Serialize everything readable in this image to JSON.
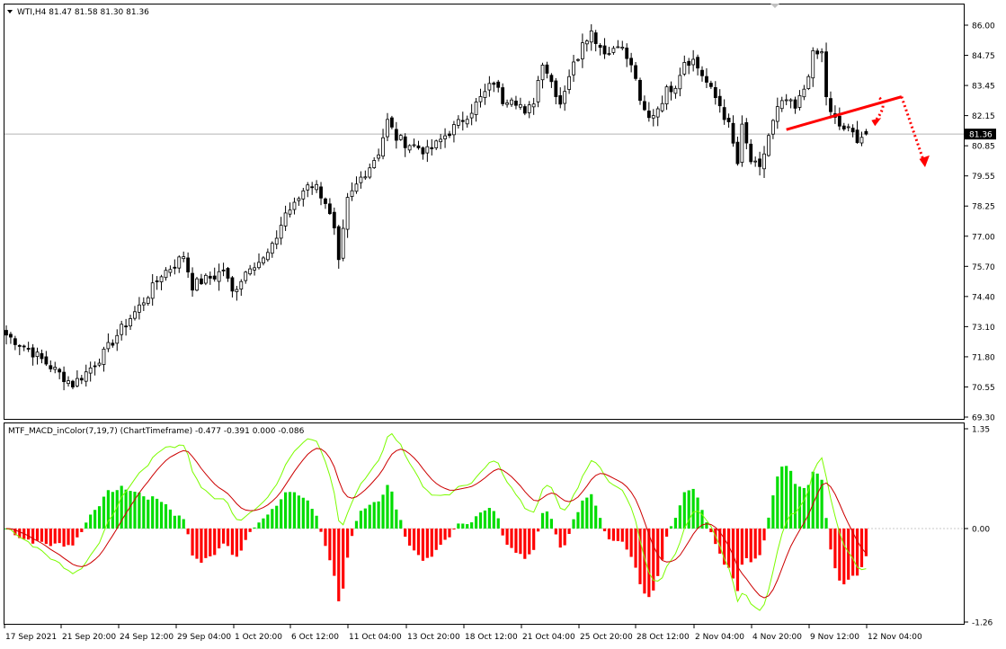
{
  "header": {
    "price_title": "WTI,H4  81.47 81.58 81.30 81.36",
    "indicator_title": "MTF_MACD_inColor(7,19,7) (ChartTimeframe) -0.477 -0.391 0.000 -0.086"
  },
  "colors": {
    "background": "#ffffff",
    "bull_candle": "#ffffff",
    "bear_candle": "#000000",
    "candle_wick": "#000000",
    "price_line": "#b4b4b4",
    "current_price_tag": "#000000",
    "annotation": "#ff0000",
    "macd_line": "#7cfc00",
    "signal_line": "#cc0000",
    "histogram_positive": "#00dd00",
    "histogram_negative": "#ff0000"
  },
  "chart_data": [
    {
      "type": "candlestick",
      "symbol": "WTI",
      "timeframe": "H4",
      "ohlc_last": {
        "open": 81.47,
        "high": 81.58,
        "low": 81.3,
        "close": 81.36
      },
      "current_price": "81.36",
      "ylim": [
        69.3,
        86.0
      ],
      "y_ticks": [
        "86.00",
        "84.75",
        "83.45",
        "82.15",
        "80.85",
        "79.55",
        "78.25",
        "77.00",
        "75.70",
        "74.40",
        "73.10",
        "71.80",
        "70.55",
        "69.30"
      ],
      "x_ticks": [
        "17 Sep 2021",
        "21 Sep 20:00",
        "24 Sep 12:00",
        "29 Sep 04:00",
        "1 Oct 20:00",
        "6 Oct 12:00",
        "11 Oct 04:00",
        "13 Oct 20:00",
        "18 Oct 12:00",
        "21 Oct 04:00",
        "25 Oct 20:00",
        "28 Oct 12:00",
        "2 Nov 04:00",
        "4 Nov 20:00",
        "9 Nov 12:00",
        "12 Nov 04:00"
      ],
      "close_path": [
        [
          0,
          72.8
        ],
        [
          5,
          72.2
        ],
        [
          9,
          71.6
        ],
        [
          13,
          71.0
        ],
        [
          15,
          70.7
        ],
        [
          18,
          71.2
        ],
        [
          22,
          72.0
        ],
        [
          25,
          72.8
        ],
        [
          27,
          73.3
        ],
        [
          30,
          74.0
        ],
        [
          33,
          74.8
        ],
        [
          35,
          75.4
        ],
        [
          38,
          75.8
        ],
        [
          40,
          76.2
        ],
        [
          42,
          74.9
        ],
        [
          44,
          75.1
        ],
        [
          47,
          75.3
        ],
        [
          49,
          75.6
        ],
        [
          51,
          74.6
        ],
        [
          53,
          75.2
        ],
        [
          55,
          75.8
        ],
        [
          58,
          76.0
        ],
        [
          60,
          76.5
        ],
        [
          63,
          78.0
        ],
        [
          65,
          78.3
        ],
        [
          68,
          79.3
        ],
        [
          70,
          79.1
        ],
        [
          72,
          78.5
        ],
        [
          74,
          77.2
        ],
        [
          75,
          75.8
        ],
        [
          77,
          78.5
        ],
        [
          80,
          79.5
        ],
        [
          82,
          80.0
        ],
        [
          84,
          80.6
        ],
        [
          86,
          81.9
        ],
        [
          88,
          81.2
        ],
        [
          90,
          81.0
        ],
        [
          93,
          80.8
        ],
        [
          95,
          80.6
        ],
        [
          97,
          80.9
        ],
        [
          99,
          81.3
        ],
        [
          102,
          81.8
        ],
        [
          105,
          82.4
        ],
        [
          108,
          83.1
        ],
        [
          110,
          83.6
        ],
        [
          112,
          82.8
        ],
        [
          114,
          83.0
        ],
        [
          116,
          82.6
        ],
        [
          117,
          82.1
        ],
        [
          119,
          82.8
        ],
        [
          121,
          84.5
        ],
        [
          123,
          83.6
        ],
        [
          125,
          82.7
        ],
        [
          127,
          83.9
        ],
        [
          129,
          84.7
        ],
        [
          130,
          85.4
        ],
        [
          132,
          85.7
        ],
        [
          134,
          85.1
        ],
        [
          136,
          84.8
        ],
        [
          138,
          85.3
        ],
        [
          140,
          84.6
        ],
        [
          142,
          83.8
        ],
        [
          143,
          82.6
        ],
        [
          145,
          82.0
        ],
        [
          147,
          82.5
        ],
        [
          149,
          83.2
        ],
        [
          151,
          83.5
        ],
        [
          153,
          84.5
        ],
        [
          155,
          84.5
        ],
        [
          157,
          83.9
        ],
        [
          159,
          83.2
        ],
        [
          161,
          82.6
        ],
        [
          163,
          81.7
        ],
        [
          165,
          80.1
        ],
        [
          166,
          81.6
        ],
        [
          168,
          80.2
        ],
        [
          170,
          79.8
        ],
        [
          172,
          81.3
        ],
        [
          174,
          82.4
        ],
        [
          176,
          82.8
        ],
        [
          178,
          82.4
        ],
        [
          180,
          83.3
        ],
        [
          182,
          84.7
        ],
        [
          184,
          84.8
        ],
        [
          185,
          83.0
        ],
        [
          186,
          82.2
        ],
        [
          188,
          81.7
        ],
        [
          190,
          81.5
        ],
        [
          192,
          81.2
        ],
        [
          194,
          81.36
        ]
      ]
    },
    {
      "type": "macd",
      "name": "MTF_MACD_inColor(7,19,7) (ChartTimeframe)",
      "values": {
        "macd": -0.477,
        "signal": -0.391,
        "zero": 0.0,
        "histogram": -0.086
      },
      "ylim": [
        -1.26,
        1.35
      ],
      "y_ticks": [
        "1.35",
        "0.00",
        "-1.26"
      ]
    }
  ]
}
